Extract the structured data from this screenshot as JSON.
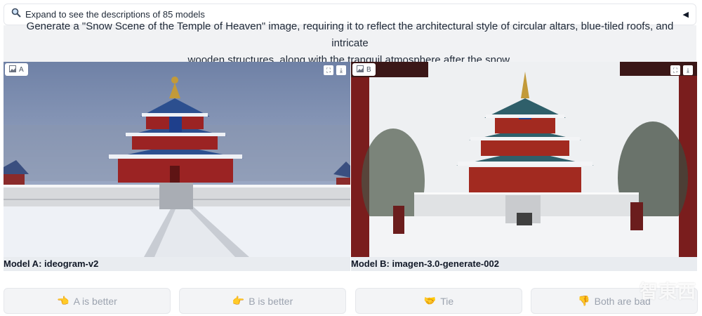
{
  "accordion": {
    "label": "Expand to see the descriptions of 85 models",
    "icon": "magnifier-icon",
    "caret": "◀"
  },
  "prompt": {
    "line1": "Generate a \"Snow Scene of the Temple of Heaven\" image, requiring it to reflect the architectural style of circular altars, blue-tiled roofs, and intricate",
    "line2": "wooden structures, along with the tranquil atmosphere after the snow."
  },
  "panels": [
    {
      "badge": "A",
      "model": "Model A: ideogram-v2"
    },
    {
      "badge": "B",
      "model": "Model B: imagen-3.0-generate-002"
    }
  ],
  "vote": {
    "a_better": "A is better",
    "b_better": "B is better",
    "tie": "Tie",
    "both_bad": "Both are bad"
  },
  "watermark": "智東西",
  "colors": {
    "accent_roof_blue": "#2c4f8f",
    "temple_red": "#9b2323",
    "snow": "#eef1f6",
    "button_text": "#9ca3af"
  }
}
